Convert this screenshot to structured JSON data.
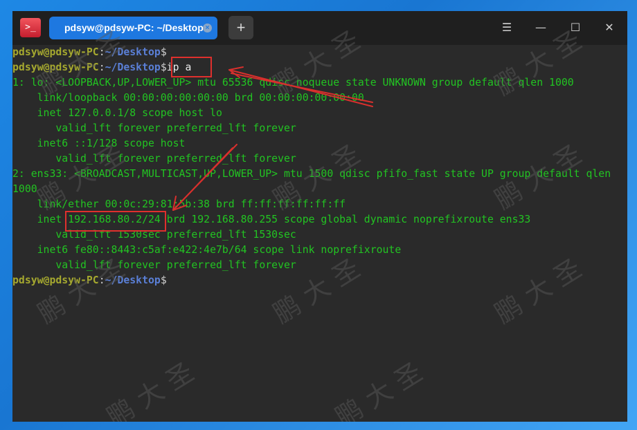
{
  "window": {
    "tab_title": "pdsyw@pdsyw-PC: ~/Desktop",
    "tab_close_glyph": "×",
    "new_tab_glyph": "+",
    "app_icon_glyph": ">_",
    "menu_glyph": "☰",
    "minimize_glyph": "—",
    "maximize_glyph": "☐",
    "close_glyph": "✕"
  },
  "prompt": {
    "user_host": "pdsyw@pdsyw-PC",
    "colon": ":",
    "path": "~/Desktop",
    "dollar": "$"
  },
  "command": "ip a",
  "output": [
    "1: lo: <LOOPBACK,UP,LOWER_UP> mtu 65536 qdisc noqueue state UNKNOWN group default qlen 1000",
    "    link/loopback 00:00:00:00:00:00 brd 00:00:00:00:00:00",
    "    inet 127.0.0.1/8 scope host lo",
    "       valid_lft forever preferred_lft forever",
    "    inet6 ::1/128 scope host",
    "       valid_lft forever preferred_lft forever",
    "2: ens33: <BROADCAST,MULTICAST,UP,LOWER_UP> mtu 1500 qdisc pfifo_fast state UP group default qlen",
    "1000",
    "    link/ether 00:0c:29:81:5b:38 brd ff:ff:ff:ff:ff:ff",
    "    inet 192.168.80.2/24 brd 192.168.80.255 scope global dynamic noprefixroute ens33",
    "       valid_lft 1530sec preferred_lft 1530sec",
    "    inet6 fe80::8443:c5af:e422:4e7b/64 scope link noprefixroute",
    "       valid_lft forever preferred_lft forever"
  ],
  "watermark": "鹏 大 圣",
  "colors": {
    "prompt_user": "#a5a82f",
    "prompt_path": "#5a7fd6",
    "output_text": "#22c422",
    "annotation": "#e0302d",
    "tab_active": "#1e78e0"
  }
}
